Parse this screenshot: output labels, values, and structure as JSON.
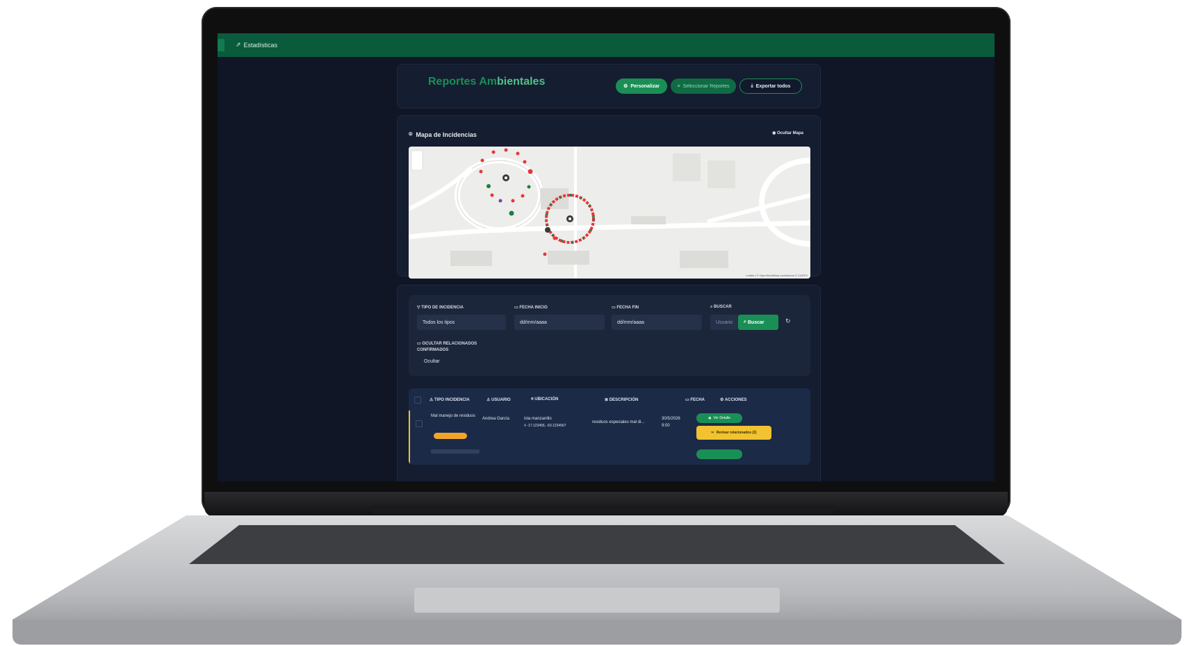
{
  "nav": {
    "stats_label": "Estadísticas"
  },
  "header": {
    "title_part1": "Reportes Am",
    "title_part2": "bientales",
    "personalize_label": "Personalizar",
    "select_reports_label": "Seleccionar Reportes",
    "export_all_label": "Exportar todos"
  },
  "map": {
    "title": "Mapa de Incidencias",
    "hide_label": "Ocultar Mapa",
    "attribution": "Leaflet | © OpenStreetMap contributors © CARTO"
  },
  "filters": {
    "type_label": "TIPO DE INCIDENCIA",
    "type_value": "Todos los tipos",
    "start_label": "FECHA INICIO",
    "start_placeholder": "dd/mm/aaaa",
    "end_label": "FECHA FIN",
    "end_placeholder": "dd/mm/aaaa",
    "search_label": "BUSCAR",
    "search_placeholder": "Usuario",
    "search_button": "Buscar",
    "hide_related_label": "OCULTAR RELACIONADOS CONFIRMADOS",
    "hide_related_value": "Ocultar"
  },
  "table": {
    "headers": [
      "TIPO INCIDENCIA",
      "USUARIO",
      "UBICACIÓN",
      "DESCRIPCIÓN",
      "FECHA",
      "ACCIONES"
    ],
    "rows": [
      {
        "type": "Mal manejo de residuos",
        "user": "Andrea García",
        "location": "Isla manzanillo",
        "coords": "-17.123456, -63.1234567",
        "description": "residuos especiales mal di...",
        "date": "30/5/2026",
        "time": "9:00",
        "view_label": "Ver Detalle",
        "review_label": "Revisar relacionados (2)"
      }
    ]
  },
  "colors": {
    "accent": "#1a8f55",
    "background": "#101626",
    "warning": "#f2c230"
  }
}
